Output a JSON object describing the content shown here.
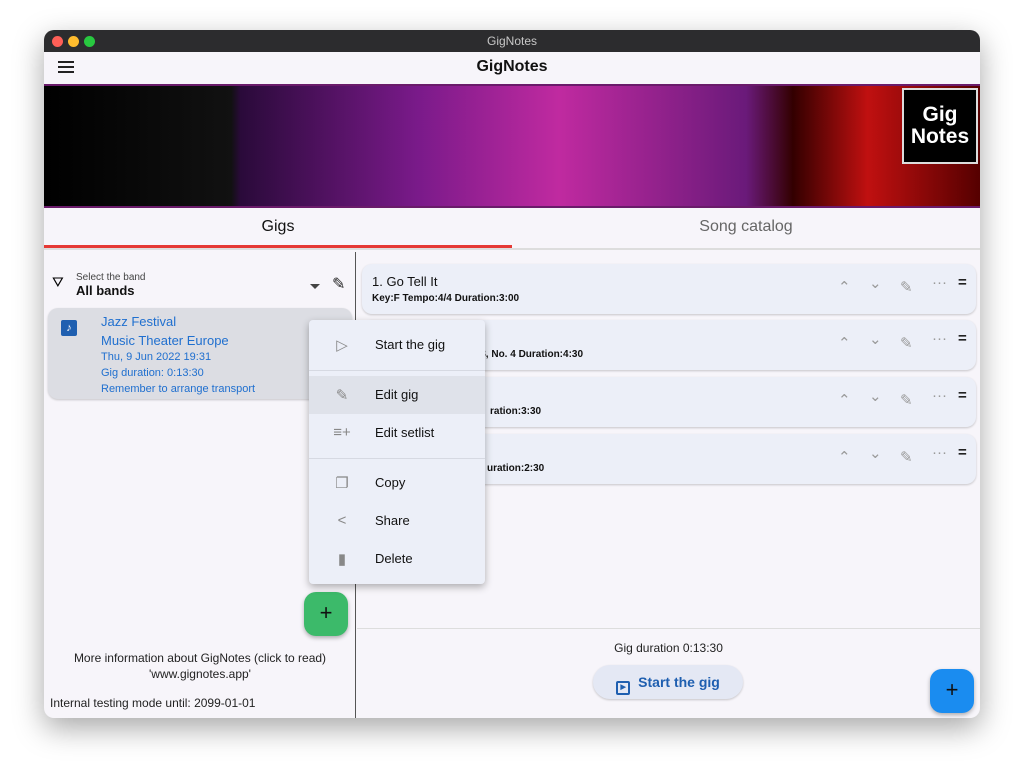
{
  "window": {
    "title": "GigNotes"
  },
  "appbar": {
    "title": "GigNotes"
  },
  "banner": {
    "logo": "Gig Notes"
  },
  "tabs": [
    {
      "label": "Gigs",
      "active": true
    },
    {
      "label": "Song catalog",
      "active": false
    }
  ],
  "band_filter": {
    "label": "Select the band",
    "value": "All bands"
  },
  "gig": {
    "name": "Jazz Festival",
    "venue": "Music Theater Europe",
    "date": "Thu, 9 Jun 2022 19:31",
    "duration": "Gig duration: 0:13:30",
    "note": "Remember to arrange transport"
  },
  "context_menu": [
    {
      "label": "Start the gig",
      "icon": "play-box-icon"
    },
    {
      "label": "Edit gig",
      "icon": "pencil-icon"
    },
    {
      "label": "Edit setlist",
      "icon": "playlist-add-icon"
    },
    {
      "label": "Copy",
      "icon": "copy-icon"
    },
    {
      "label": "Share",
      "icon": "share-icon"
    },
    {
      "label": "Delete",
      "icon": "trash-icon"
    }
  ],
  "songs": [
    {
      "name": "1. Go Tell It",
      "details": "Key:F  Tempo:4/4  Duration:3:00"
    },
    {
      "name": "",
      "details": "p. 28, No. 4  Duration:4:30"
    },
    {
      "name": "",
      "details": "ration:3:30"
    },
    {
      "name": "",
      "details": "uration:2:30"
    }
  ],
  "footer": {
    "info": "More information about GigNotes (click to read)",
    "link": "'www.gignotes.app'",
    "testing": "Internal testing mode until: 2099-01-01"
  },
  "setlist_footer": {
    "duration": "Gig duration 0:13:30",
    "start_button": "Start the gig"
  },
  "colors": {
    "accent": "#1f5fb0",
    "tab_indicator": "#e53935",
    "fab_green": "#3cba6a",
    "fab_blue": "#1a8cf0"
  }
}
